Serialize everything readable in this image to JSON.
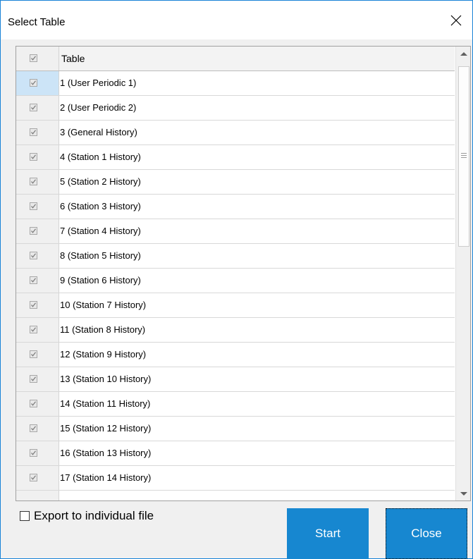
{
  "window": {
    "title": "Select Table",
    "close_glyph": "×"
  },
  "grid": {
    "header": {
      "label": "Table",
      "checked": true
    },
    "rows": [
      {
        "label": "1 (User Periodic 1)",
        "checked": true,
        "selected": true
      },
      {
        "label": "2 (User Periodic 2)",
        "checked": true
      },
      {
        "label": "3 (General History)",
        "checked": true
      },
      {
        "label": "4 (Station 1 History)",
        "checked": true
      },
      {
        "label": "5 (Station 2 History)",
        "checked": true
      },
      {
        "label": "6 (Station 3 History)",
        "checked": true
      },
      {
        "label": "7 (Station 4 History)",
        "checked": true
      },
      {
        "label": "8 (Station 5 History)",
        "checked": true
      },
      {
        "label": "9 (Station 6 History)",
        "checked": true
      },
      {
        "label": "10 (Station 7 History)",
        "checked": true
      },
      {
        "label": "11 (Station 8 History)",
        "checked": true
      },
      {
        "label": "12 (Station 9 History)",
        "checked": true
      },
      {
        "label": "13 (Station 10 History)",
        "checked": true
      },
      {
        "label": "14 (Station 11 History)",
        "checked": true
      },
      {
        "label": "15 (Station 12 History)",
        "checked": true
      },
      {
        "label": "16 (Station 13 History)",
        "checked": true
      },
      {
        "label": "17 (Station 14 History)",
        "checked": true
      },
      {
        "label": "",
        "checked": false
      }
    ]
  },
  "footer": {
    "export_label": "Export to individual file",
    "export_checked": false,
    "start_label": "Start",
    "close_label": "Close"
  },
  "colors": {
    "accent": "#1787d0",
    "border": "#1883d7",
    "selected_row": "#cce4f7"
  }
}
